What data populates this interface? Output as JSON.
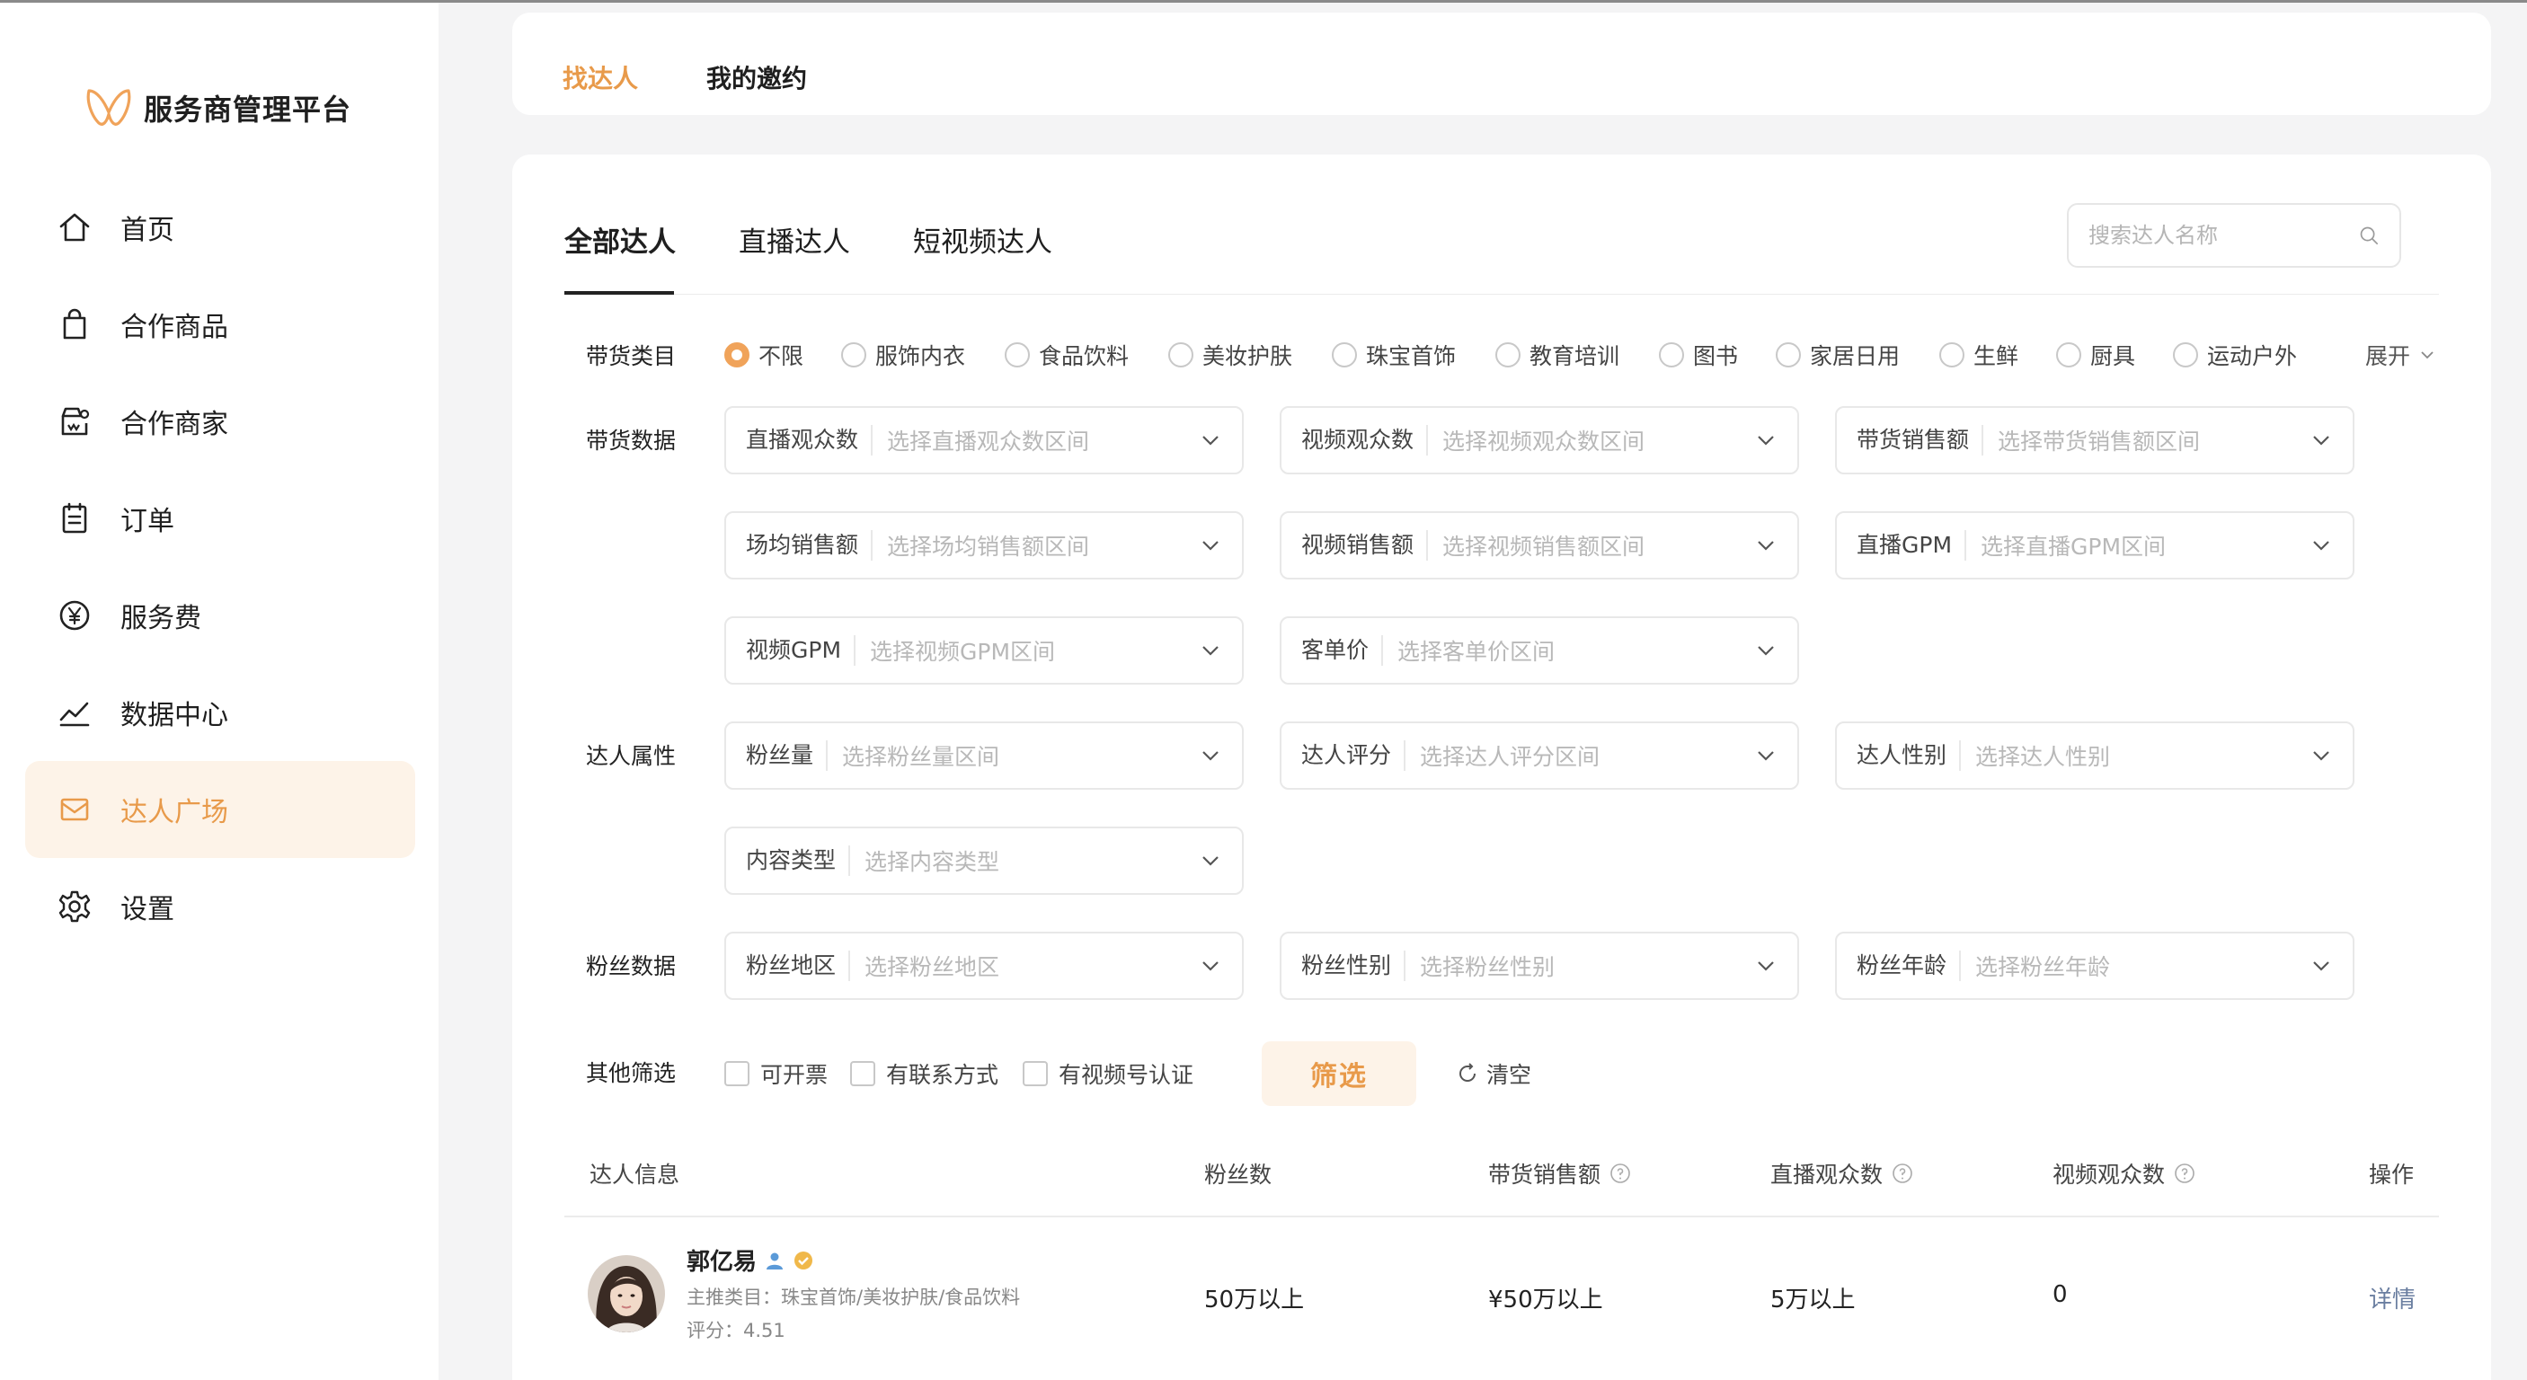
{
  "brand": {
    "name": "服务商管理平台",
    "logo": "butterfly-logo"
  },
  "sidebar": {
    "items": [
      {
        "label": "首页",
        "icon": "home-icon"
      },
      {
        "label": "合作商品",
        "icon": "shopping-bag-icon"
      },
      {
        "label": "合作商家",
        "icon": "store-icon"
      },
      {
        "label": "订单",
        "icon": "clipboard-icon"
      },
      {
        "label": "服务费",
        "icon": "yen-circle-icon"
      },
      {
        "label": "数据中心",
        "icon": "chart-line-icon"
      },
      {
        "label": "达人广场",
        "icon": "mail-icon",
        "active": true
      },
      {
        "label": "设置",
        "icon": "gear-icon"
      }
    ]
  },
  "top_tabs": [
    {
      "label": "找达人",
      "active": true
    },
    {
      "label": "我的邀约",
      "active": false
    }
  ],
  "sub_tabs": [
    {
      "label": "全部达人",
      "active": true
    },
    {
      "label": "直播达人",
      "active": false
    },
    {
      "label": "短视频达人",
      "active": false
    }
  ],
  "search": {
    "placeholder": "搜索达人名称"
  },
  "filters": {
    "category_label": "带货类目",
    "categories": [
      "不限",
      "服饰内衣",
      "食品饮料",
      "美妆护肤",
      "珠宝首饰",
      "教育培训",
      "图书",
      "家居日用",
      "生鲜",
      "厨具",
      "运动户外"
    ],
    "selected_category": "不限",
    "expand_label": "展开",
    "sales_data_label": "带货数据",
    "sales_data": [
      {
        "key": "直播观众数",
        "placeholder": "选择直播观众数区间"
      },
      {
        "key": "视频观众数",
        "placeholder": "选择视频观众数区间"
      },
      {
        "key": "带货销售额",
        "placeholder": "选择带货销售额区间"
      },
      {
        "key": "场均销售额",
        "placeholder": "选择场均销售额区间"
      },
      {
        "key": "视频销售额",
        "placeholder": "选择视频销售额区间"
      },
      {
        "key": "直播GPM",
        "placeholder": "选择直播GPM区间"
      },
      {
        "key": "视频GPM",
        "placeholder": "选择视频GPM区间"
      },
      {
        "key": "客单价",
        "placeholder": "选择客单价区间"
      }
    ],
    "creator_attr_label": "达人属性",
    "creator_attrs": [
      {
        "key": "粉丝量",
        "placeholder": "选择粉丝量区间"
      },
      {
        "key": "达人评分",
        "placeholder": "选择达人评分区间"
      },
      {
        "key": "达人性别",
        "placeholder": "选择达人性别"
      },
      {
        "key": "内容类型",
        "placeholder": "选择内容类型"
      }
    ],
    "fan_data_label": "粉丝数据",
    "fan_data": [
      {
        "key": "粉丝地区",
        "placeholder": "选择粉丝地区"
      },
      {
        "key": "粉丝性别",
        "placeholder": "选择粉丝性别"
      },
      {
        "key": "粉丝年龄",
        "placeholder": "选择粉丝年龄"
      }
    ],
    "other_label": "其他筛选",
    "other_checks": [
      "可开票",
      "有联系方式",
      "有视频号认证"
    ],
    "filter_button": "筛选",
    "clear_button": "清空"
  },
  "table": {
    "headers": {
      "info": "达人信息",
      "fans": "粉丝数",
      "sales": "带货销售额",
      "live_viewers": "直播观众数",
      "video_viewers": "视频观众数",
      "action": "操作"
    },
    "rows": [
      {
        "name": "郭亿易",
        "main_category": "主推类目：珠宝首饰/美妆护肤/食品饮料",
        "rating": "评分：4.51",
        "fans": "50万以上",
        "sales": "¥50万以上",
        "live_viewers": "5万以上",
        "video_viewers": "0",
        "action": "详情"
      }
    ]
  },
  "colors": {
    "accent": "#e89a4a",
    "accent_bg": "#fdf3e8",
    "link": "#6a7ea0"
  }
}
